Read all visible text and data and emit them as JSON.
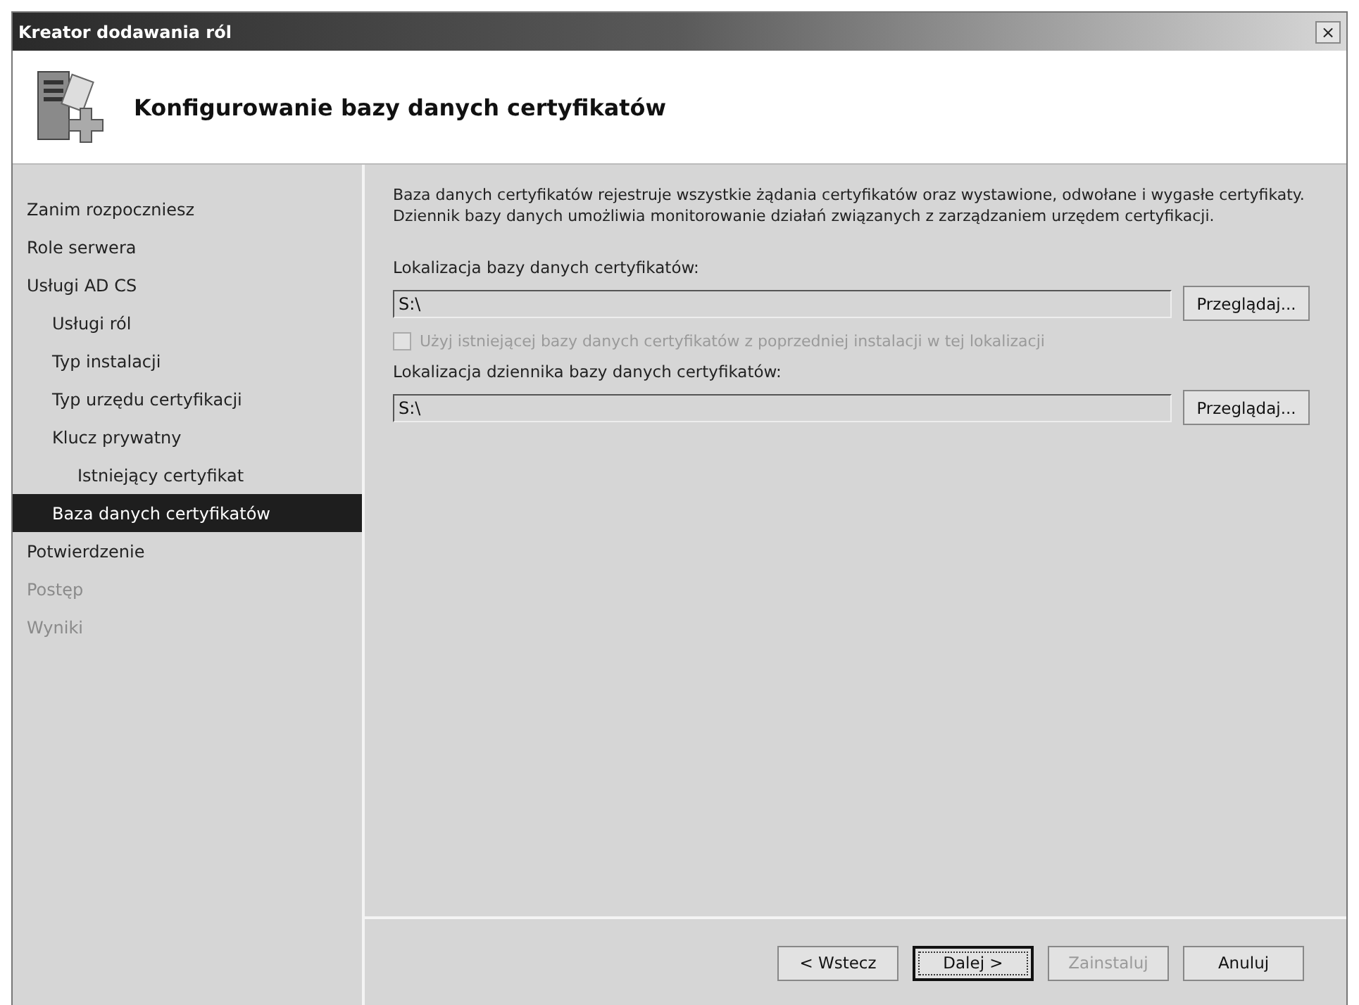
{
  "window": {
    "title": "Kreator dodawania ról",
    "close": "×"
  },
  "header": {
    "title": "Konfigurowanie bazy danych certyfikatów"
  },
  "sidebar": {
    "items": [
      {
        "label": "Zanim rozpoczniesz",
        "selected": false,
        "disabled": false
      },
      {
        "label": "Role serwera",
        "selected": false,
        "disabled": false
      },
      {
        "label": "Usługi AD CS",
        "selected": false,
        "disabled": false,
        "children": [
          {
            "label": "Usługi ról",
            "selected": false,
            "disabled": false
          },
          {
            "label": "Typ instalacji",
            "selected": false,
            "disabled": false
          },
          {
            "label": "Typ urzędu certyfikacji",
            "selected": false,
            "disabled": false
          },
          {
            "label": "Klucz prywatny",
            "selected": false,
            "disabled": false,
            "children": [
              {
                "label": "Istniejący certyfikat",
                "selected": false,
                "disabled": false
              }
            ]
          },
          {
            "label": "Baza danych certyfikatów",
            "selected": true,
            "disabled": false
          }
        ]
      },
      {
        "label": "Potwierdzenie",
        "selected": false,
        "disabled": false
      },
      {
        "label": "Postęp",
        "selected": false,
        "disabled": true
      },
      {
        "label": "Wyniki",
        "selected": false,
        "disabled": true
      }
    ]
  },
  "content": {
    "description": "Baza danych certyfikatów rejestruje wszystkie żądania certyfikatów oraz wystawione, odwołane i wygasłe certyfikaty. Dziennik bazy danych umożliwia monitorowanie działań związanych z zarządzaniem urzędem certyfikacji.",
    "database_location": {
      "label": "Lokalizacja bazy danych certyfikatów:",
      "value": "S:\\",
      "button": "Przeglądaj..."
    },
    "reuse_checkbox": {
      "label": "Użyj istniejącej bazy danych certyfikatów z poprzedniej instalacji w tej lokalizacji",
      "checked": false,
      "disabled": true
    },
    "log_location": {
      "label": "Lokalizacja dziennika bazy danych certyfikatów:",
      "value": "S:\\",
      "button": "Przeglądaj..."
    }
  },
  "footer": {
    "buttons": [
      {
        "label": "< Wstecz",
        "disabled": false,
        "default": false
      },
      {
        "label": "Dalej >",
        "disabled": false,
        "default": true
      },
      {
        "label": "Zainstaluj",
        "disabled": true,
        "default": false
      },
      {
        "label": "Anuluj",
        "disabled": false,
        "default": false
      }
    ]
  }
}
